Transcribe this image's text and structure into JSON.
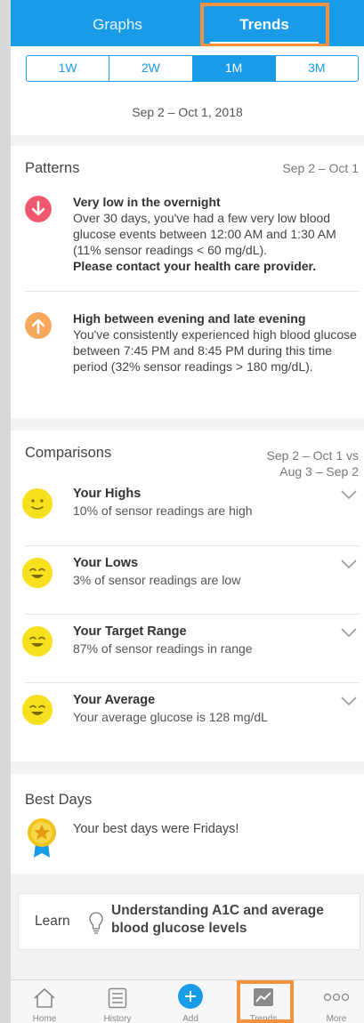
{
  "tabs": {
    "graphs": "Graphs",
    "trends": "Trends"
  },
  "periods": [
    "1W",
    "2W",
    "1M",
    "3M"
  ],
  "active_period": "1M",
  "date_range": "Sep 2 – Oct 1, 2018",
  "patterns": {
    "title": "Patterns",
    "range": "Sep 2 – Oct 1",
    "items": [
      {
        "icon": "arrow-down-icon",
        "color": "#f0566d",
        "title": "Very low in the overnight",
        "body": "Over 30 days, you've had a few very low blood glucose events between 12:00 AM and 1:30 AM (11% sensor readings < 60 mg/dL).",
        "note": "Please contact your health care provider."
      },
      {
        "icon": "arrow-up-icon",
        "color": "#f7a85c",
        "title": "High between evening and late evening",
        "body": "You've consistently experienced high blood glucose between 7:45 PM and 8:45 PM during this time period (32% sensor readings > 180 mg/dL)."
      }
    ]
  },
  "comparisons": {
    "title": "Comparisons",
    "range_line1": "Sep 2 – Oct 1 vs",
    "range_line2": "Aug 3 – Sep 2",
    "items": [
      {
        "title": "Your Highs",
        "subtitle": "10% of sensor readings are high"
      },
      {
        "title": "Your Lows",
        "subtitle": "3% of sensor readings are low"
      },
      {
        "title": "Your Target Range",
        "subtitle": "87% of sensor readings in range"
      },
      {
        "title": "Your Average",
        "subtitle": "Your average glucose is 128 mg/dL"
      }
    ]
  },
  "best_days": {
    "title": "Best Days",
    "text": "Your best days were Fridays!"
  },
  "learn": {
    "label": "Learn",
    "text": "Understanding A1C and average blood glucose levels"
  },
  "nav": [
    "Home",
    "History",
    "Add",
    "Trends",
    "More"
  ],
  "colors": {
    "accent": "#1a9be8",
    "highlight": "#f39240",
    "smiley": "#f7e11e"
  }
}
